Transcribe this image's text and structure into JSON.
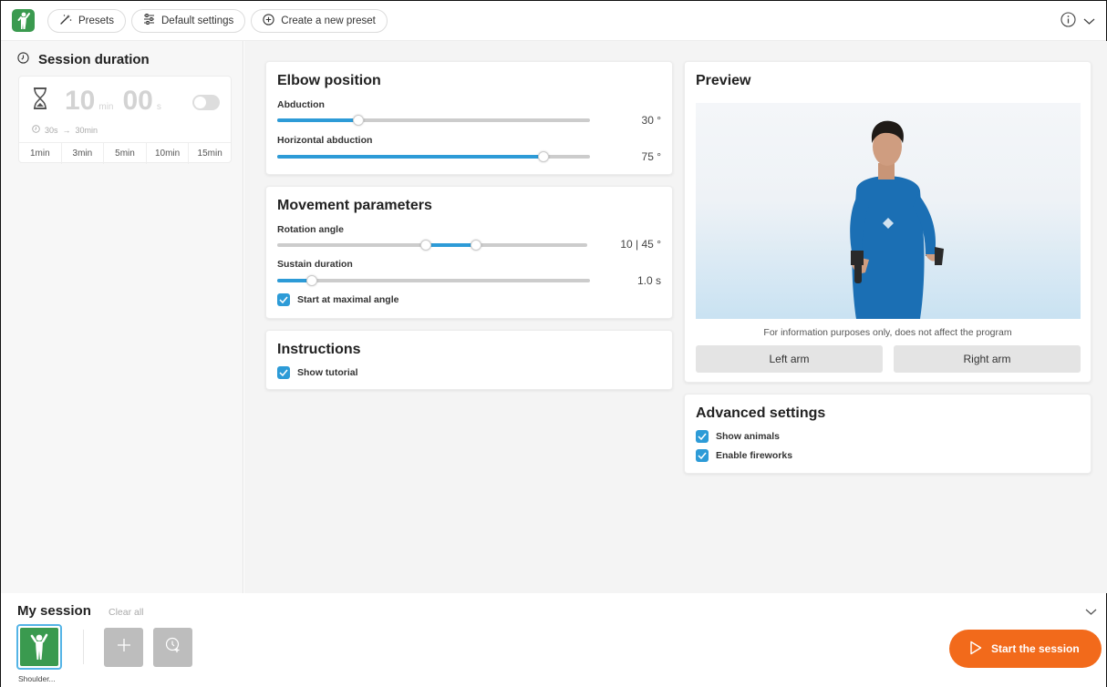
{
  "toolbar": {
    "presets_label": "Presets",
    "default_settings_label": "Default settings",
    "create_preset_label": "Create a new preset"
  },
  "session_duration": {
    "title": "Session duration",
    "minutes": "10",
    "min_unit": "min",
    "seconds": "00",
    "sec_unit": "s",
    "range_min": "30s",
    "range_arrow": "→",
    "range_max": "30min",
    "presets": [
      "1min",
      "3min",
      "5min",
      "10min",
      "15min"
    ]
  },
  "elbow_position": {
    "title": "Elbow position",
    "abduction_label": "Abduction",
    "abduction_value": "30 °",
    "abduction_fraction": 0.26,
    "horizontal_abduction_label": "Horizontal abduction",
    "horizontal_abduction_value": "75 °",
    "horizontal_abduction_fraction": 0.85
  },
  "movement_parameters": {
    "title": "Movement parameters",
    "rotation_angle_label": "Rotation angle",
    "rotation_angle_value": "10 | 45 °",
    "rotation_range_fraction": [
      0.48,
      0.64
    ],
    "sustain_duration_label": "Sustain duration",
    "sustain_duration_value": "1.0 s",
    "sustain_fraction": 0.11,
    "start_at_max_label": "Start at maximal angle"
  },
  "instructions": {
    "title": "Instructions",
    "show_tutorial_label": "Show tutorial"
  },
  "preview": {
    "title": "Preview",
    "note": "For information purposes only, does not affect the program",
    "left_arm_label": "Left arm",
    "right_arm_label": "Right arm"
  },
  "advanced_settings": {
    "title": "Advanced settings",
    "show_animals_label": "Show animals",
    "enable_fireworks_label": "Enable fireworks"
  },
  "my_session": {
    "title": "My session",
    "clear_all_label": "Clear all",
    "tile_label": "Shoulder..."
  },
  "start_button_label": "Start the session",
  "colors": {
    "accent_blue": "#2d9bd7",
    "start_orange": "#f26a1b",
    "exercise_green": "#3a9a4f",
    "avatar_shirt": "#1b6fb4"
  }
}
